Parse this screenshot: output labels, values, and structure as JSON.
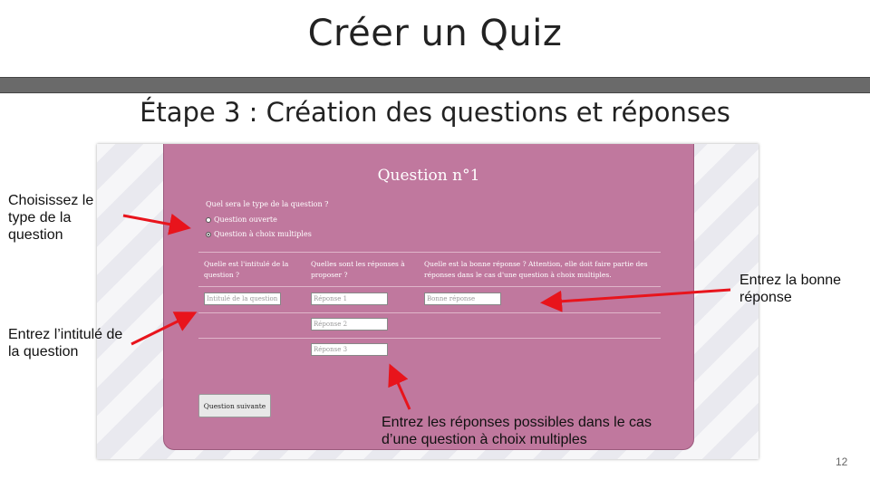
{
  "slide": {
    "title": "Créer un Quiz",
    "subtitle": "Étape 3 : Création des questions et réponses",
    "page_number": "12"
  },
  "form": {
    "question_title": "Question n°1",
    "type_label": "Quel sera le type de la question ?",
    "type_options": [
      {
        "label": "Question ouverte",
        "checked": false
      },
      {
        "label": "Question à choix multiples",
        "checked": true
      }
    ],
    "columns": [
      "Quelle est l'intitulé de la question ?",
      "Quelles sont les réponses à proposer ?",
      "Quelle est la bonne réponse ? Attention, elle doit faire partie des réponses dans le cas d'une question à choix multiples."
    ],
    "question_input_placeholder": "Intitulé de la question",
    "answer_placeholders": [
      "Réponse 1",
      "Réponse 2",
      "Réponse 3"
    ],
    "correct_answer_placeholder": "Bonne réponse",
    "next_button_label": "Question suivante"
  },
  "annotations": {
    "choose_type": "Choisissez le type de la question",
    "enter_title": "Entrez l’intitulé de la question",
    "enter_correct": "Entrez la bonne réponse",
    "enter_answers": "Entrez les réponses possibles dans le cas d’une question à choix multiples"
  },
  "colors": {
    "panel": "#c0789e",
    "arrow": "#e8141c",
    "title_bar": "#6a6a6a"
  }
}
